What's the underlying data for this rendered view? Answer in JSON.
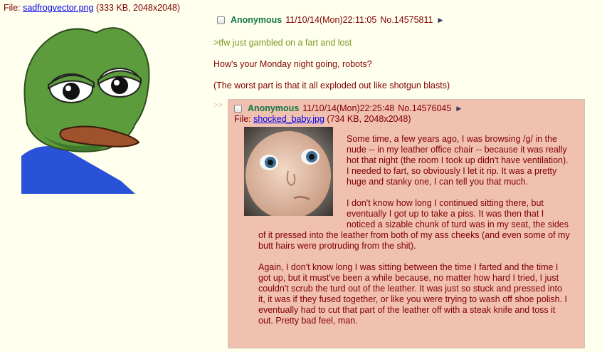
{
  "op": {
    "file_label": "File: ",
    "file_name": "sadfrogvector.png",
    "file_meta": " (333 KB, 2048x2048)",
    "name": "Anonymous",
    "datetime": "11/10/14(Mon)22:11:05",
    "post_no": "No.14575811",
    "arrow": "▶",
    "greentext": ">tfw just gambled on a fart and lost",
    "lines": [
      "How's your Monday night going, robots?",
      "(The worst part is that it all exploded out like shotgun blasts)"
    ]
  },
  "reply": {
    "indicator": ">>",
    "name": "Anonymous",
    "datetime": "11/10/14(Mon)22:25:48",
    "post_no": "No.14576045",
    "arrow": "▶",
    "file_label": "File: ",
    "file_name": "shocked_baby.jpg",
    "file_meta": " (734 KB, 2048x2048)",
    "paragraphs": [
      "Some time, a few years ago, I was browsing /g/ in the nude -- in my leather office chair -- because it was really hot that night (the room I took up didn't have ventilation). I needed to fart, so obviously I let it rip. It was a pretty huge and stanky one, I can tell you that much.",
      "I don't know how long I continued sitting there, but eventually I got up to take a piss. It was then that I noticed a sizable chunk of turd was in my seat, the sides of it pressed into the leather from both of my ass cheeks (and even some of my butt hairs were protruding from the shit).",
      "Again, I don't know long I was sitting between the time I farted and the time I got up, but it must've been a while because, no matter how hard I tried, I just couldn't scrub the turd out of the leather. It was just so stuck and pressed into it, it was if they fused together, or like you were trying to wash off shoe polish. I eventually had to cut that part of the leather off with a steak knife and toss it out. Pretty bad feel, man."
    ]
  }
}
